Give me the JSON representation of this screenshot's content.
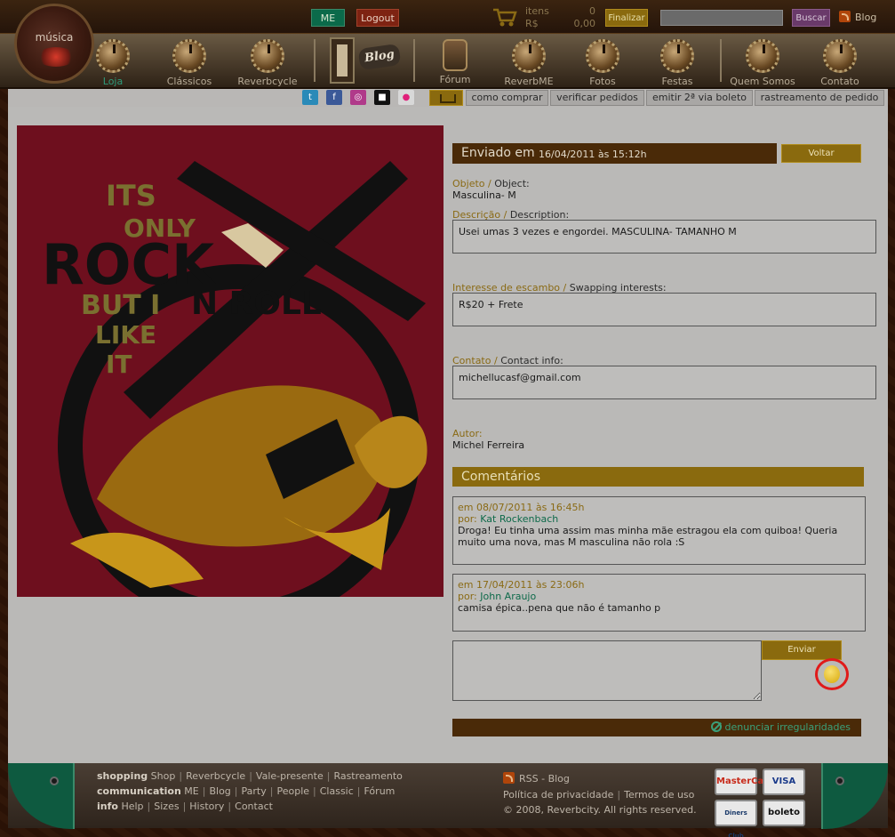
{
  "header": {
    "me_label": "ME",
    "logout_label": "Logout",
    "cart_items_label": "itens",
    "cart_currency_label": "R$",
    "cart_items_count": "0",
    "cart_total": "0,00",
    "finalizar_label": "Finalizar",
    "search_placeholder": "",
    "buscar_label": "Buscar",
    "blog_label": "Blog"
  },
  "logo": {
    "text": "música",
    "icon": "eye-logo-icon"
  },
  "nav": {
    "items": [
      {
        "label": "Loja",
        "active": true
      },
      {
        "label": "Clássicos"
      },
      {
        "label": "Reverbcycle"
      },
      {
        "label": "Fórum"
      },
      {
        "label": "ReverbME"
      },
      {
        "label": "Fotos"
      },
      {
        "label": "Festas"
      },
      {
        "label": "Quem Somos"
      },
      {
        "label": "Contato"
      }
    ],
    "blog_badge": "Blog"
  },
  "subbar": {
    "links": [
      "como comprar",
      "verificar pedidos",
      "emitir 2ª via boleto",
      "rastreamento de pedido"
    ],
    "social_icons": [
      "twitter-icon",
      "facebook-icon",
      "instagram-icon",
      "square-icon",
      "flickr-icon"
    ]
  },
  "product": {
    "sent_title": "Enviado em",
    "sent_date": "16/04/2011 às 15:12h",
    "voltar_label": "Voltar",
    "objeto_label": "Objeto / ",
    "objeto_label_en": "Object:",
    "objeto_value": "Masculina- M",
    "descricao_label": "Descrição / ",
    "descricao_label_en": "Description:",
    "descricao_value": "Usei umas 3 vezes e engordei. MASCULINA- TAMANHO M",
    "interesse_label": "Interesse de escambo / ",
    "interesse_label_en": "Swapping interests:",
    "interesse_value": "R$20 + Frete",
    "contato_label": "Contato / ",
    "contato_label_en": "Contact info:",
    "contato_value": "michellucasf@gmail.com",
    "autor_label": "Autor:",
    "autor_value": "Michel Ferreira"
  },
  "poster": {
    "line1": "ITS",
    "line2": "ONLY",
    "line3": "ROCK",
    "line4": "BUT I",
    "line5": "N ROLL",
    "line6": "LIKE",
    "line7": "IT"
  },
  "comments": {
    "title": "Comentários",
    "items": [
      {
        "date": "em 08/07/2011 às 16:45h",
        "por": "por:",
        "author": "Kat Rockenbach",
        "text": "Droga! Eu tinha uma assim mas minha mãe estragou ela com quiboa! Queria muito uma nova, mas M masculina não rola :S"
      },
      {
        "date": "em 17/04/2011 às 23:06h",
        "por": "por:",
        "author": "John Araujo",
        "text": "camisa épica..pena que não é tamanho p"
      }
    ],
    "enviar_label": "Enviar",
    "report_label": "denunciar irregularidades"
  },
  "footer": {
    "line1_title": "shopping",
    "line1_links": [
      "Shop",
      "Reverbcycle",
      "Vale-presente",
      "Rastreamento"
    ],
    "line2_title": "communication",
    "line2_links": [
      "ME",
      "Blog",
      "Party",
      "People",
      "Classic",
      "Fórum"
    ],
    "line3_title": "info",
    "line3_links": [
      "Help",
      "Sizes",
      "History",
      "Contact"
    ],
    "rss_label": "RSS - Blog",
    "privacy": "Política de privacidade",
    "terms": "Termos de uso",
    "copyright": "© 2008, Reverbcity. All rights reserved.",
    "cards": [
      "MasterCard",
      "VISA",
      "Diners Club",
      "boleto"
    ]
  },
  "colors": {
    "gold": "#8a6a0e",
    "dark_brown": "#4a2a08",
    "green": "#0e6a4a",
    "content_bg": "#bab9b7"
  }
}
